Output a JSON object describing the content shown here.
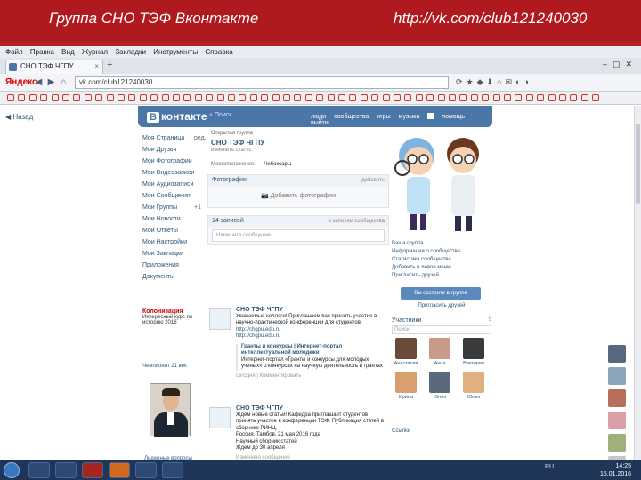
{
  "slide": {
    "title_left": "Группа СНО ТЭФ Вконтакте",
    "title_right": "http://vk.com/club121240030"
  },
  "browser": {
    "menu": [
      "Файл",
      "Правка",
      "Вид",
      "Журнал",
      "Закладки",
      "Инструменты",
      "Справка"
    ],
    "tab_title": "СНО ТЭФ ЧГПУ",
    "url": "vk.com/club121240030",
    "yandex_label": "Яндекс",
    "back_label": "Назад"
  },
  "vk": {
    "logo": "контакте",
    "logo_badge": "В",
    "search_placeholder": "Поиск",
    "top_nav": [
      "люди",
      "сообщества",
      "игры",
      "музыка",
      "помощь",
      "выйти"
    ],
    "left_menu": [
      {
        "label": "Моя Страница",
        "count": "ред."
      },
      {
        "label": "Мои Друзья",
        "count": ""
      },
      {
        "label": "Мои Фотографии",
        "count": ""
      },
      {
        "label": "Мои Видеозаписи",
        "count": ""
      },
      {
        "label": "Мои Аудиозаписи",
        "count": ""
      },
      {
        "label": "Мои Сообщения",
        "count": ""
      },
      {
        "label": "Мои Группы",
        "count": "+1"
      },
      {
        "label": "Мои Новости",
        "count": ""
      },
      {
        "label": "Мои Ответы",
        "count": ""
      },
      {
        "label": "Мои Настройки",
        "count": ""
      },
      {
        "label": "Мои Закладки",
        "count": ""
      },
      {
        "label": "Приложения",
        "count": ""
      },
      {
        "label": "Документы",
        "count": ""
      }
    ],
    "ad": {
      "title": "Колонизация",
      "text": "Интересный курс по историю 2016"
    },
    "ad2": "Чемпионат 21 век",
    "ad3": "Лидерные вопросы записи",
    "group": {
      "type": "Открытая группа",
      "name": "СНО ТЭФ ЧГПУ",
      "status": "изменить статус",
      "info_label": "Местоположение:",
      "info_value": "Чебоксары"
    },
    "photos_block": {
      "title": "Фотографии",
      "right": "добавить",
      "add": "Добавить фотографии"
    },
    "wall_block": {
      "title": "14 записей",
      "right": "к записям сообщества",
      "placeholder": "Напишите сообщение..."
    },
    "posts": [
      {
        "author": "СНО ТЭФ ЧГПУ",
        "text": "Уважаемые коллеги! Приглашаем вас принять участие в научно-практической конференции для студентов.",
        "links": [
          "http://chgpu.edu.ru",
          "http://chgpu.edu.ru"
        ],
        "repost_title": "Гранты и конкурсы | Интернет-портал интеллектуальной молодежи",
        "repost_text": "Интернет-портал «Гранты и конкурсы для молодых ученых» о конкурсах на научную деятельность и грантах",
        "meta": "сегодня | Комментировать"
      },
      {
        "author": "СНО ТЭФ ЧГПУ",
        "text": "Ждем новые статьи! Кафедра приглашает студентов принять участие в конференции ТЭФ. Публикация статей в сборнике РИНЦ.",
        "extra": "Россия, Тамбов, 21 мая 2016 года",
        "extra2": "Научный сборник статей",
        "extra3": "Ждем до 30 апреля",
        "meta": "Изменено сообщение"
      }
    ],
    "right_panel": {
      "links": [
        "Ваша группа",
        "Информация о сообществе",
        "Статистика сообщества",
        "Добавить в левое меню",
        "Пригласить друзей"
      ],
      "button": "Вы состоите в группе",
      "button_link": "Пригласить друзей",
      "members_title": "Участники",
      "members_count": "5",
      "member_search": "Поиск",
      "member_names": [
        "Анастасия",
        "Анна",
        "Виктория",
        "Ирина",
        "Юлия",
        "Юлия"
      ],
      "footer": "Ссылки"
    }
  },
  "taskbar": {
    "tray": "RU",
    "time": "14:25",
    "date": "15.01.2016"
  }
}
